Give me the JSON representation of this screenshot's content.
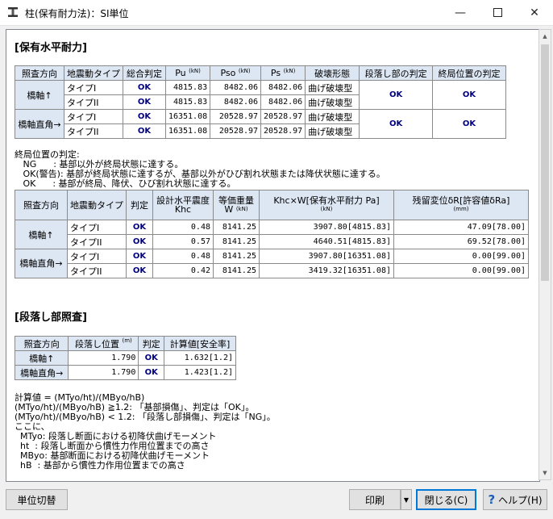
{
  "window": {
    "title": "柱(保有耐力法)：SI単位"
  },
  "s1": {
    "heading": "[保有水平耐力]"
  },
  "t1": {
    "h": [
      "照査方向",
      "地震動タイプ",
      "総合判定",
      "Pu",
      "Pso",
      "Ps",
      "破壊形態",
      "段落し部の判定",
      "終局位置の判定"
    ],
    "u": "(kN)",
    "groups": [
      "橋軸↑",
      "橋軸直角→"
    ],
    "types": [
      "タイプI",
      "タイプII"
    ],
    "rows": [
      [
        "OK",
        "4815.83",
        "8482.06",
        "8482.06",
        "曲げ破壊型"
      ],
      [
        "OK",
        "4815.83",
        "8482.06",
        "8482.06",
        "曲げ破壊型"
      ],
      [
        "OK",
        "16351.08",
        "20528.97",
        "20528.97",
        "曲げ破壊型"
      ],
      [
        "OK",
        "16351.08",
        "20528.97",
        "20528.97",
        "曲げ破壊型"
      ]
    ],
    "dan": [
      "OK",
      "OK"
    ],
    "shu": [
      "OK",
      "OK"
    ]
  },
  "notes1": [
    "終局位置の判定:",
    "   NG      : 基部以外が終局状態に達する。",
    "   OK(警告): 基部が終局状態に達するが、基部以外がひび割れ状態または降伏状態に達する。",
    "   OK      : 基部が終局、降伏、ひび割れ状態に達する。"
  ],
  "t2": {
    "h": [
      "照査方向",
      "地震動タイプ",
      "判定",
      "設計水平震度",
      "Khc",
      "等価重量",
      "W",
      "Khc×W[保有水平耐力 Pa]",
      "残留変位δR[許容値δRa]"
    ],
    "u": "(kN)",
    "um": "(mm)",
    "groups": [
      "橋軸↑",
      "橋軸直角→"
    ],
    "rows": [
      [
        "OK",
        "0.48",
        "8141.25",
        "3907.80[4815.83]",
        "47.09[78.00]"
      ],
      [
        "OK",
        "0.57",
        "8141.25",
        "4640.51[4815.83]",
        "69.52[78.00]"
      ],
      [
        "OK",
        "0.48",
        "8141.25",
        "3907.80[16351.08]",
        "0.00[99.00]"
      ],
      [
        "OK",
        "0.42",
        "8141.25",
        "3419.32[16351.08]",
        "0.00[99.00]"
      ]
    ]
  },
  "s2": {
    "heading": "[段落し部照査]"
  },
  "t3": {
    "h": [
      "照査方向",
      "段落し位置",
      "判定",
      "計算値[安全率]"
    ],
    "um": "(m)",
    "rows": [
      [
        "橋軸↑",
        "1.790",
        "OK",
        "1.632[1.2]"
      ],
      [
        "橋軸直角→",
        "1.790",
        "OK",
        "1.423[1.2]"
      ]
    ]
  },
  "notes2": [
    "計算値 = (MTyo/ht)/(MByo/hB)",
    "(MTyo/ht)/(MByo/hB) ≧1.2: 「基部損傷」、判定は「OK」。",
    "(MTyo/ht)/(MByo/hB) < 1.2: 「段落し部損傷」、判定は「NG」。",
    "ここに、",
    "  MTyo: 段落し断面における初降伏曲げモーメント",
    "  ht  : 段落し断面から慣性力作用位置までの高さ",
    "  MByo: 基部断面における初降伏曲げモーメント",
    "  hB  : 基部から慣性力作用位置までの高さ"
  ],
  "buttons": {
    "unit": "単位切替",
    "print": "印刷",
    "close": "閉じる(C)",
    "help": "ヘルプ(H)"
  }
}
